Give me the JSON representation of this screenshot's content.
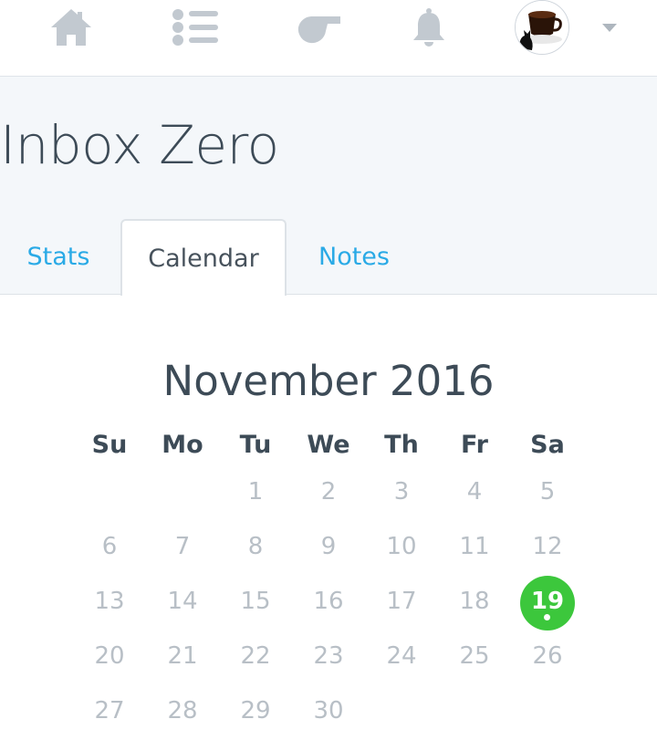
{
  "nav": {
    "icons": [
      "home-icon",
      "list-icon",
      "whistle-icon",
      "bell-icon"
    ],
    "avatar": "avatar-coffee-cat",
    "dropdown": "chevron-down-icon"
  },
  "header": {
    "title": "Inbox Zero"
  },
  "tabs": [
    {
      "label": "Stats",
      "active": false
    },
    {
      "label": "Calendar",
      "active": true
    },
    {
      "label": "Notes",
      "active": false
    }
  ],
  "calendar": {
    "month_label": "November 2016",
    "weekdays": [
      "Su",
      "Mo",
      "Tu",
      "We",
      "Th",
      "Fr",
      "Sa"
    ],
    "first_weekday_index": 2,
    "days": [
      "1",
      "2",
      "3",
      "4",
      "5",
      "6",
      "7",
      "8",
      "9",
      "10",
      "11",
      "12",
      "13",
      "14",
      "15",
      "16",
      "17",
      "18",
      "19",
      "20",
      "21",
      "22",
      "23",
      "24",
      "25",
      "26",
      "27",
      "28",
      "29",
      "30"
    ],
    "today": "19",
    "colors": {
      "today": "#3cc73c",
      "day_text": "#b8bfc6",
      "tab_link": "#2aaae6"
    }
  }
}
